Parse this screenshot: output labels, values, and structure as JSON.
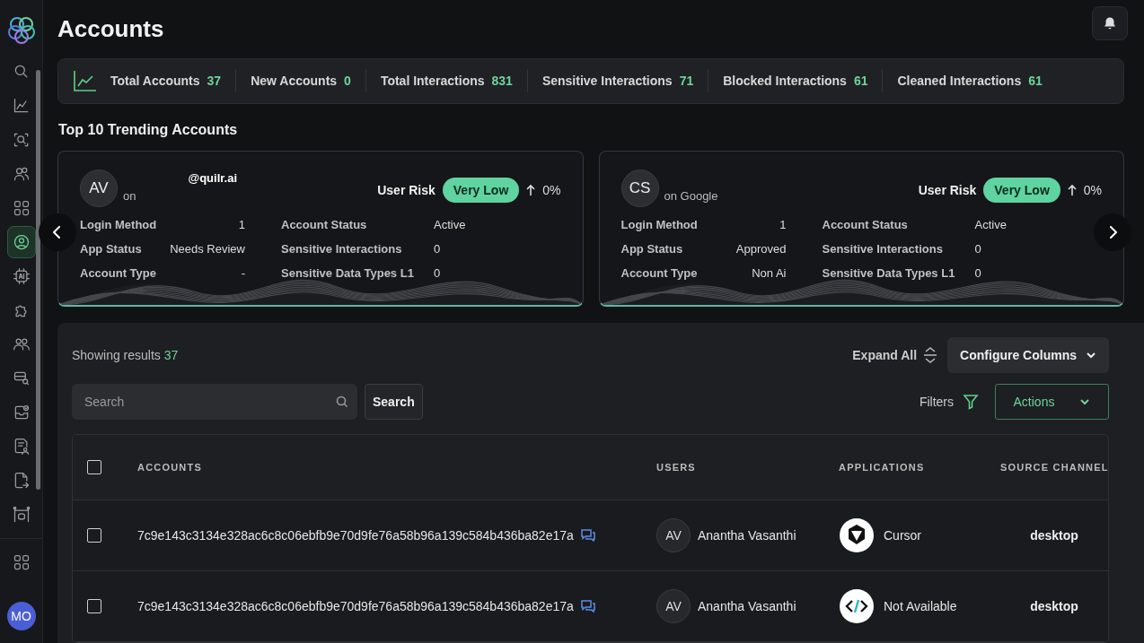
{
  "sidebar": {
    "items": [
      {
        "selected": false
      },
      {
        "selected": false
      },
      {
        "selected": false
      },
      {
        "selected": false
      },
      {
        "selected": false
      },
      {
        "selected": true
      },
      {
        "selected": false
      },
      {
        "selected": false
      },
      {
        "selected": false
      },
      {
        "selected": false
      },
      {
        "selected": false
      },
      {
        "selected": false
      },
      {
        "selected": false
      },
      {
        "selected": false
      }
    ],
    "bottom_items": [
      {
        "selected": false
      }
    ],
    "avatar": "MO"
  },
  "page": {
    "title": "Accounts"
  },
  "stats": [
    {
      "label": "Total Accounts",
      "value": "37"
    },
    {
      "label": "New Accounts",
      "value": "0"
    },
    {
      "label": "Total Interactions",
      "value": "831"
    },
    {
      "label": "Sensitive Interactions",
      "value": "71"
    },
    {
      "label": "Blocked Interactions",
      "value": "61"
    },
    {
      "label": "Cleaned Interactions",
      "value": "61"
    }
  ],
  "trending": {
    "title": "Top 10 Trending Accounts",
    "cards": [
      {
        "initials": "AV",
        "email": "@quilr.ai",
        "provider": "on",
        "risk_label": "User Risk",
        "risk": "Very Low",
        "change": "0%",
        "fields": [
          {
            "label": "Login Method",
            "value": "1"
          },
          {
            "label": "Account Status",
            "value": "Active"
          },
          {
            "label": "App Status",
            "value": "Needs Review"
          },
          {
            "label": "Sensitive Interactions",
            "value": "0"
          },
          {
            "label": "Account Type",
            "value": "-"
          },
          {
            "label": "Sensitive Data Types L1",
            "value": "0"
          }
        ]
      },
      {
        "initials": "CS",
        "provider": "on Google",
        "risk_label": "User Risk",
        "risk": "Very Low",
        "change": "0%",
        "fields": [
          {
            "label": "Login Method",
            "value": "1"
          },
          {
            "label": "Account Status",
            "value": "Active"
          },
          {
            "label": "App Status",
            "value": "Approved"
          },
          {
            "label": "Sensitive Interactions",
            "value": "0"
          },
          {
            "label": "Account Type",
            "value": "Non Ai"
          },
          {
            "label": "Sensitive Data Types L1",
            "value": "0"
          }
        ]
      }
    ]
  },
  "results": {
    "label": "Showing results",
    "count": "37",
    "expand": "Expand All",
    "configure": "Configure Columns",
    "search_placeholder": "Search",
    "search_button": "Search",
    "filters": "Filters",
    "actions": "Actions"
  },
  "table": {
    "header_checked": false,
    "columns": [
      "ACCOUNTS",
      "USERS",
      "APPLICATIONS",
      "SOURCE CHANNEL"
    ],
    "rows": [
      {
        "checked": false,
        "account": "7c9e143c3134e328ac6c8c06ebfb9e70d9fe76a58b96a139c584b436ba82e17a",
        "user_initials": "AV",
        "user": "Anantha Vasanthi",
        "kind": "cursor",
        "application": "Cursor",
        "channel": "desktop"
      },
      {
        "checked": false,
        "account": "7c9e143c3134e328ac6c8c06ebfb9e70d9fe76a58b96a139c584b436ba82e17a",
        "user_initials": "AV",
        "user": "Anantha Vasanthi",
        "kind": "code",
        "application": "Not Available",
        "channel": "desktop"
      }
    ]
  }
}
